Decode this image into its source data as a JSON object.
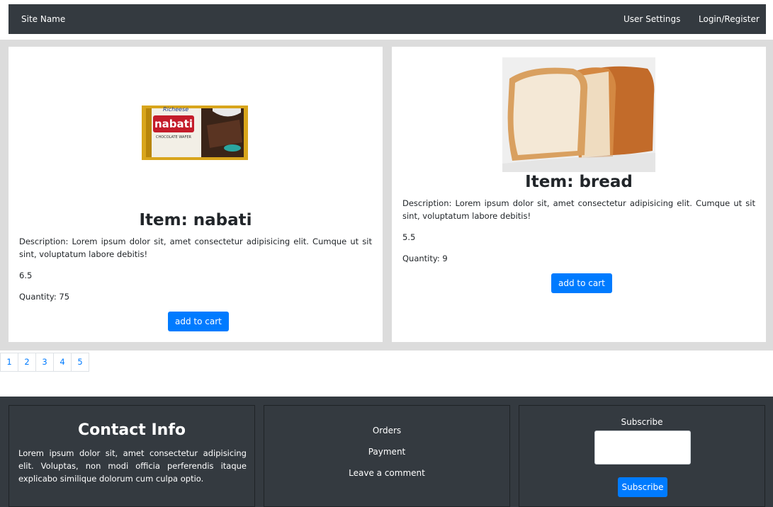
{
  "navbar": {
    "brand": "Site Name",
    "user_settings": "User Settings",
    "login_register": "Login/Register"
  },
  "products": [
    {
      "title": "Item: nabati",
      "description": "Description: Lorem ipsum dolor sit, amet consectetur adipisicing elit. Cumque ut sit sint, voluptatum labore debitis!",
      "price": "6.5",
      "quantity": "Quantity: 75",
      "button": "add to cart",
      "image_brand": "Richeese",
      "image_name": "nabati",
      "image_sub": "CHOCOLATE WAFER"
    },
    {
      "title": "Item: bread",
      "description": "Description: Lorem ipsum dolor sit, amet consectetur adipisicing elit. Cumque ut sit sint, voluptatum labore debitis!",
      "price": "5.5",
      "quantity": "Quantity: 9",
      "button": "add to cart"
    }
  ],
  "pagination": [
    "1",
    "2",
    "3",
    "4",
    "5"
  ],
  "footer": {
    "contact_title": "Contact Info",
    "contact_text": "Lorem ipsum dolor sit, amet consectetur adipisicing elit. Voluptas, non modi officia perferendis itaque explicabo similique dolorum cum culpa optio.",
    "links": [
      "Orders",
      "Payment",
      "Leave a comment"
    ],
    "subscribe_label": "Subscribe",
    "subscribe_button": "Subscribe",
    "subscribe_value": ""
  },
  "colors": {
    "navbar": "#343a40",
    "primary": "#007bff",
    "band": "#dcdcdc"
  }
}
